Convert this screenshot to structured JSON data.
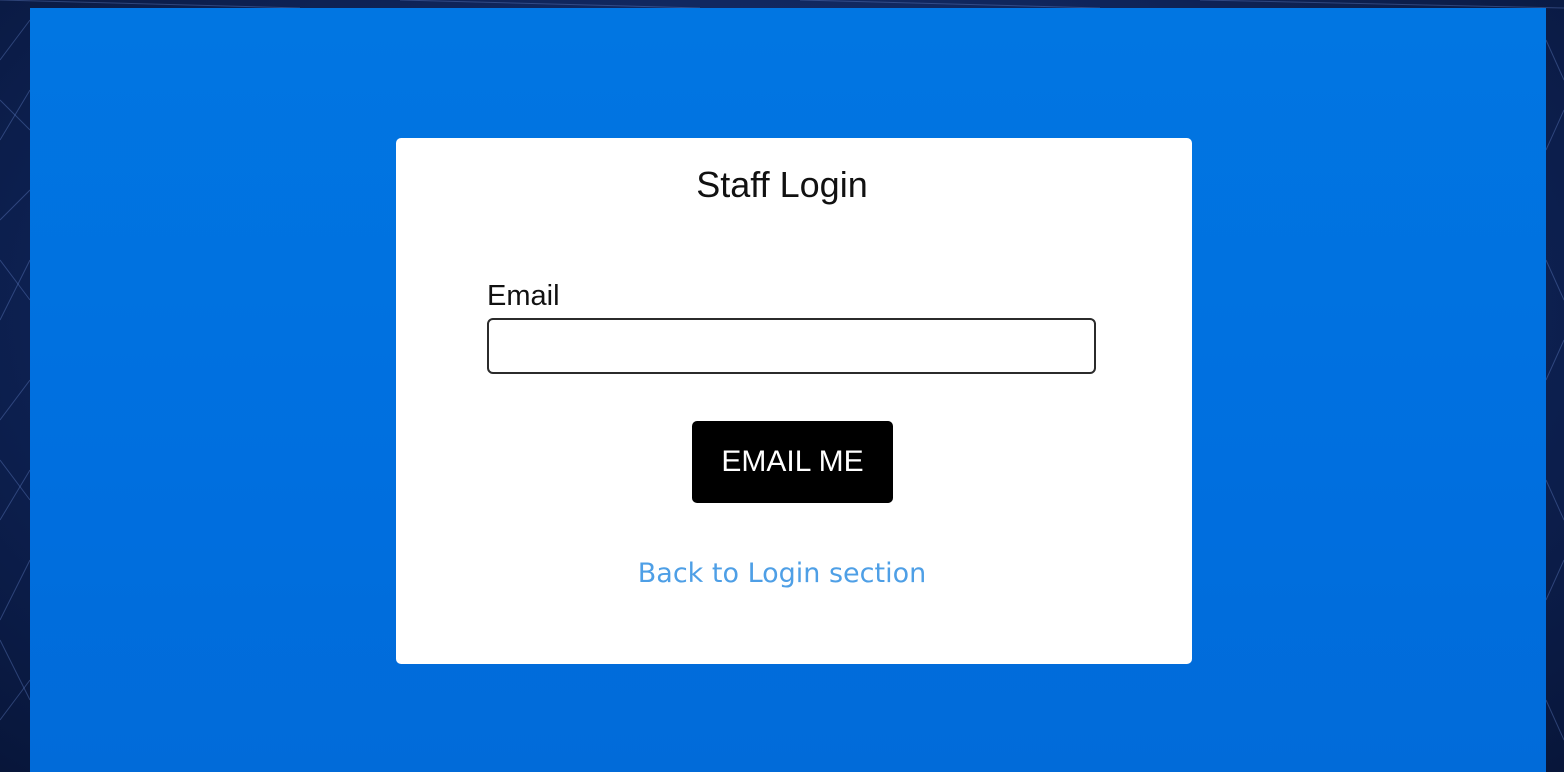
{
  "page": {
    "background_color": "#0a1a3a",
    "panel_color": "#0176e2"
  },
  "login_card": {
    "title": "Staff Login",
    "email_label": "Email",
    "email_value": "",
    "email_placeholder": "",
    "submit_label": "EMAIL ME",
    "back_link_label": "Back to Login section",
    "button_color": "#000000",
    "link_color": "#4e9fe6"
  }
}
